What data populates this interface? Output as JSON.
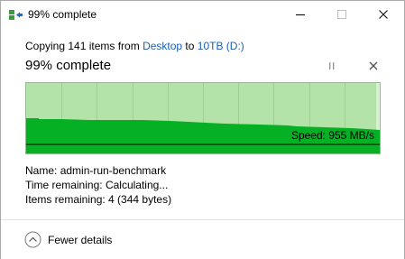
{
  "window": {
    "title": "99% complete",
    "title_icon": "copy-files-icon"
  },
  "header": {
    "copying_prefix": "Copying 141 items from ",
    "source": "Desktop",
    "to_word": " to ",
    "destination": "10TB (D:)",
    "percent_text": "99% complete",
    "progress_fraction": 0.99
  },
  "graph": {
    "speed_label": "Speed: 955 MB/s",
    "speed_line_mbps": 955,
    "colors": {
      "completed_bg": "#b3e3a8",
      "remaining_bg": "#d9f0d3",
      "fill": "#06b025",
      "grid": "#9ccf90",
      "speed_line": "#000000"
    }
  },
  "details": {
    "name_label": "Name:",
    "name_value": "admin-run-benchmark",
    "time_label": "Time remaining:",
    "time_value": "Calculating...",
    "items_label": "Items remaining:",
    "items_value": "4 (344 bytes)"
  },
  "footer": {
    "fewer_details_label": "Fewer details",
    "fewer_details_icon": "chevron-up-circle-icon"
  },
  "controls": {
    "minimize_icon": "minimize-icon",
    "maximize_icon": "maximize-icon",
    "close_icon": "close-icon",
    "pause_icon": "pause-icon",
    "cancel_icon": "cancel-icon"
  }
}
